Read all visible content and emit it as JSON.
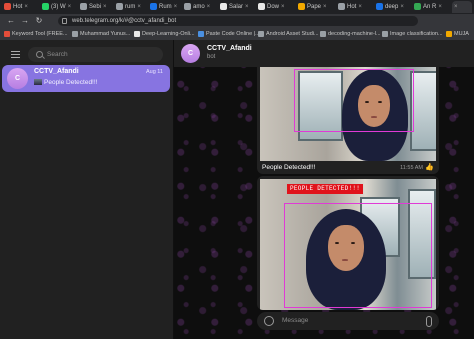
{
  "browser": {
    "tabs": [
      {
        "label": "Hot",
        "color": "#e44d3a"
      },
      {
        "label": "(3) W",
        "color": "#25d366"
      },
      {
        "label": "Sebi",
        "color": "#9aa0a6"
      },
      {
        "label": "rum",
        "color": "#9aa0a6"
      },
      {
        "label": "Rum",
        "color": "#1a73e8"
      },
      {
        "label": "amo",
        "color": "#9aa0a6"
      },
      {
        "label": "Salar",
        "color": "#e8e8e8"
      },
      {
        "label": "Dow",
        "color": "#e8e8e8"
      },
      {
        "label": "Pape",
        "color": "#f2a900"
      },
      {
        "label": "Hot",
        "color": "#9aa0a6"
      },
      {
        "label": "deep",
        "color": "#1a73e8"
      },
      {
        "label": "An R",
        "color": "#34a853"
      }
    ],
    "active_tab_label": "",
    "url": "web.telegram.org/k/#@cctv_afandi_bot",
    "bookmarks": [
      {
        "label": "Keyword Tool (FREE...",
        "color": "#e44d3a"
      },
      {
        "label": "Muhammad Yunus...",
        "color": "#9aa0a6"
      },
      {
        "label": "Deep-Learning-Onli...",
        "color": "#e8e8e8"
      },
      {
        "label": "Paste Code Online |...",
        "color": "#4a90e2"
      },
      {
        "label": "Android Asset Studi...",
        "color": "#9aa0a6"
      },
      {
        "label": "decoding-machine-l...",
        "color": "#9aa0a6"
      },
      {
        "label": "Image classification...",
        "color": "#9aa0a6"
      },
      {
        "label": "MUJA",
        "color": "#f2a900"
      }
    ]
  },
  "sidebar": {
    "search_placeholder": "Search",
    "chat": {
      "avatar_letter": "C",
      "name": "CCTV_Afandi",
      "date": "Aug 11",
      "preview": "People Detected!!!"
    }
  },
  "chat_header": {
    "avatar_letter": "C",
    "title": "CCTV_Afandi",
    "subtitle": "bot"
  },
  "messages": [
    {
      "caption": "People Detected!!!",
      "time": "11:55 AM",
      "reaction": "👍"
    },
    {
      "overlay_label": "PEOPLE DETECTED!!!"
    }
  ],
  "composer": {
    "placeholder": "Message"
  },
  "colors": {
    "accent": "#8774e1",
    "alert_red": "#e0131b",
    "detection_box": "#e03ad6"
  }
}
